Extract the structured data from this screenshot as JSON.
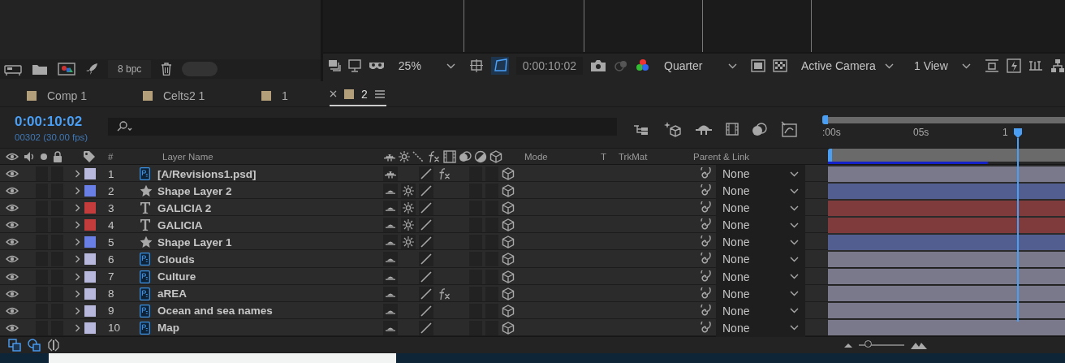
{
  "project_panel": {
    "bit_depth": "8 bpc"
  },
  "viewer_toolbar": {
    "zoom": "25%",
    "timecode": "0:00:10:02",
    "resolution": "Quarter",
    "camera": "Active Camera",
    "views": "1 View"
  },
  "tabs": [
    {
      "label": "Comp 1",
      "selected": false
    },
    {
      "label": "Celts2 1",
      "selected": false
    },
    {
      "label": "1",
      "selected": false
    },
    {
      "label": "2",
      "selected": true
    }
  ],
  "timeline": {
    "timecode": "0:00:10:02",
    "frame_info": "00302 (30.00 fps)",
    "ruler_labels": [
      ":00s",
      "05s",
      "1"
    ]
  },
  "columns": {
    "number": "#",
    "layer_name": "Layer Name",
    "mode": "Mode",
    "t": "T",
    "trkmat": "TrkMat",
    "parent": "Parent & Link"
  },
  "layers": [
    {
      "number": "1",
      "name": "[A/Revisions1.psd]",
      "kind": "psd",
      "color": "#b8b8dc",
      "visible": true,
      "shy": true,
      "effects": true,
      "parent": "None"
    },
    {
      "number": "2",
      "name": "Shape Layer 2",
      "kind": "shape",
      "color": "#6a7fe6",
      "visible": true,
      "shy": false,
      "effects": false,
      "parent": "None"
    },
    {
      "number": "3",
      "name": "GALICIA 2",
      "kind": "text",
      "color": "#c43c3c",
      "visible": true,
      "shy": false,
      "effects": false,
      "parent": "None"
    },
    {
      "number": "4",
      "name": "GALICIA",
      "kind": "text",
      "color": "#c43c3c",
      "visible": true,
      "shy": false,
      "effects": false,
      "parent": "None"
    },
    {
      "number": "5",
      "name": "Shape Layer 1",
      "kind": "shape",
      "color": "#6a7fe6",
      "visible": true,
      "shy": false,
      "effects": false,
      "parent": "None"
    },
    {
      "number": "6",
      "name": "Clouds",
      "kind": "psd",
      "color": "#b8b8dc",
      "visible": true,
      "shy": false,
      "effects": false,
      "parent": "None"
    },
    {
      "number": "7",
      "name": "Culture",
      "kind": "psd",
      "color": "#b8b8dc",
      "visible": true,
      "shy": false,
      "effects": false,
      "parent": "None"
    },
    {
      "number": "8",
      "name": "aREA",
      "kind": "psd",
      "color": "#b8b8dc",
      "visible": true,
      "shy": false,
      "effects": true,
      "parent": "None"
    },
    {
      "number": "9",
      "name": "Ocean and sea names",
      "kind": "psd",
      "color": "#b8b8dc",
      "visible": true,
      "shy": false,
      "effects": false,
      "parent": "None"
    },
    {
      "number": "10",
      "name": "Map",
      "kind": "psd",
      "color": "#b8b8dc",
      "visible": true,
      "shy": false,
      "effects": false,
      "parent": "None"
    }
  ],
  "timeline_zoom": {
    "level": 0.12
  }
}
